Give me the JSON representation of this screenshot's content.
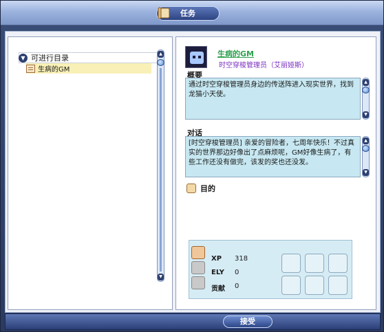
{
  "window": {
    "title": "任务"
  },
  "quest_list": {
    "category_label": "可进行目录",
    "items": [
      {
        "label": "生病的GM"
      }
    ]
  },
  "detail": {
    "quest_name": "生病的GM",
    "npc": "时空穿梭管理员（艾丽娅斯）",
    "summary_label": "概要",
    "summary_text": "通过时空穿梭管理员身边的传送阵进入现实世界，找到龙猫小天使。",
    "dialogue_label": "对话",
    "dialogue_text": "[时空穿梭管理员] 亲爱的冒险者，七周年快乐！不过真实的世界那边好像出了点麻烦呢，GM好像生病了，有些工作还没有做完，该发的奖也还没发。",
    "goal_label": "目的"
  },
  "rewards": {
    "rows": [
      {
        "key": "XP",
        "value": "318"
      },
      {
        "key": "ELY",
        "value": "0"
      },
      {
        "key": "贡献",
        "value": "0"
      }
    ]
  },
  "footer": {
    "accept_label": "接受"
  },
  "colors": {
    "accent": "#2c3f78",
    "quest_name": "#2ea04f",
    "npc": "#7a2fc0",
    "textbox": "#c7e8f2"
  }
}
